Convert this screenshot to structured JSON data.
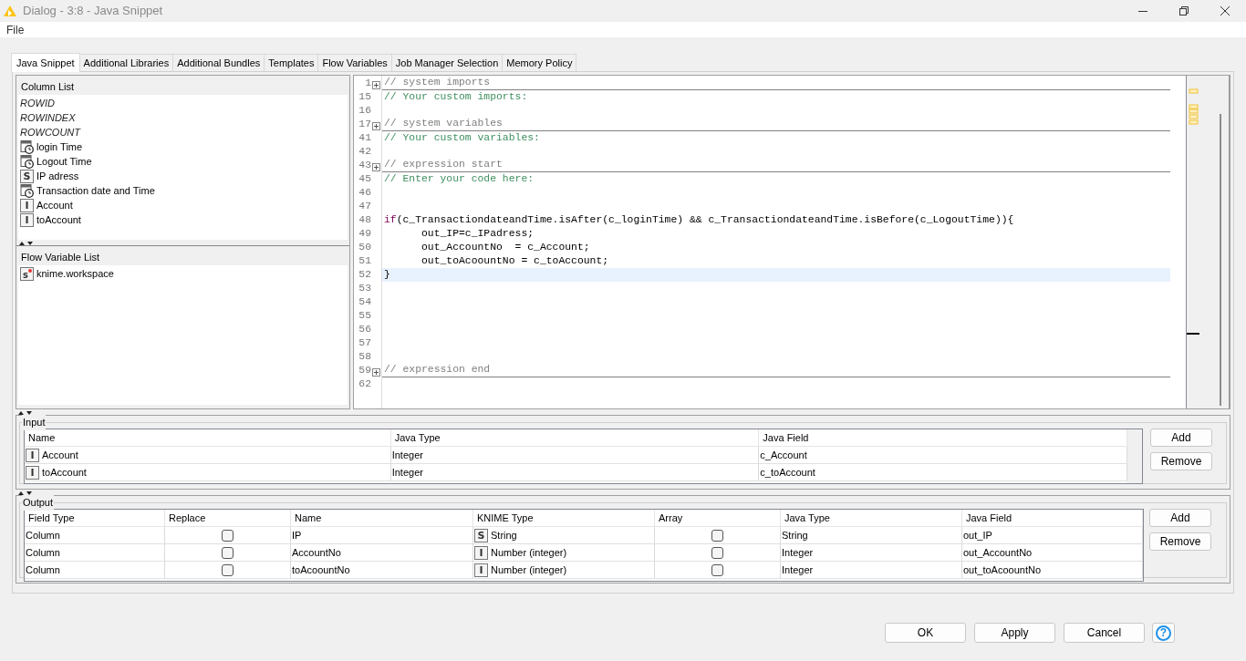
{
  "window": {
    "title": "Dialog - 3:8 - Java Snippet"
  },
  "menu": [
    "File"
  ],
  "tabs": [
    {
      "label": "Java Snippet",
      "selected": true
    },
    {
      "label": "Additional Libraries",
      "selected": false
    },
    {
      "label": "Additional Bundles",
      "selected": false
    },
    {
      "label": "Templates",
      "selected": false
    },
    {
      "label": "Flow Variables",
      "selected": false
    },
    {
      "label": "Job Manager Selection",
      "selected": false
    },
    {
      "label": "Memory Policy",
      "selected": false
    }
  ],
  "column_list": {
    "title": "Column List",
    "items": [
      {
        "label": "ROWID",
        "kind": "special"
      },
      {
        "label": "ROWINDEX",
        "kind": "special"
      },
      {
        "label": "ROWCOUNT",
        "kind": "special"
      },
      {
        "label": "login Time",
        "kind": "datetime"
      },
      {
        "label": "Logout Time",
        "kind": "datetime"
      },
      {
        "label": "IP adress",
        "kind": "typed",
        "icon": "S"
      },
      {
        "label": "Transaction date and Time",
        "kind": "datetime"
      },
      {
        "label": "Account",
        "kind": "typed",
        "icon": "I"
      },
      {
        "label": "toAccount",
        "kind": "typed",
        "icon": "I"
      }
    ]
  },
  "flow_variable_list": {
    "title": "Flow Variable List",
    "items": [
      {
        "label": "knime.workspace",
        "kind": "flow",
        "icon": "s"
      }
    ]
  },
  "editor": {
    "lines": [
      {
        "number": "1",
        "kind": "fold",
        "text": "// system imports",
        "current": false
      },
      {
        "number": "15",
        "kind": "comment",
        "text": "// Your custom imports:",
        "current": false
      },
      {
        "number": "16",
        "kind": "blank",
        "current": false
      },
      {
        "number": "17",
        "kind": "fold",
        "text": "// system variables",
        "current": false
      },
      {
        "number": "41",
        "kind": "comment",
        "text": "// Your custom variables:",
        "current": false
      },
      {
        "number": "42",
        "kind": "blank",
        "current": false
      },
      {
        "number": "43",
        "kind": "fold",
        "text": "// expression start",
        "current": false
      },
      {
        "number": "45",
        "kind": "comment",
        "text": "// Enter your code here:",
        "current": false
      },
      {
        "number": "46",
        "kind": "blank",
        "current": false
      },
      {
        "number": "47",
        "kind": "blank",
        "current": false
      },
      {
        "number": "48",
        "kind": "code",
        "keyword": "if",
        "text": "(c_TransactiondateandTime.isAfter(c_loginTime) && c_TransactiondateandTime.isBefore(c_LogoutTime)){",
        "current": false
      },
      {
        "number": "49",
        "kind": "code",
        "text": "      out_IP=c_IPadress;",
        "current": false
      },
      {
        "number": "50",
        "kind": "code",
        "text": "      out_AccountNo  = c_Account;",
        "current": false
      },
      {
        "number": "51",
        "kind": "code",
        "text": "      out_toAcoountNo = c_toAccount;",
        "current": false
      },
      {
        "number": "52",
        "kind": "code",
        "text": "}",
        "current": true
      },
      {
        "number": "53",
        "kind": "blank",
        "current": false
      },
      {
        "number": "54",
        "kind": "blank",
        "current": false
      },
      {
        "number": "55",
        "kind": "blank",
        "current": false
      },
      {
        "number": "56",
        "kind": "blank",
        "current": false
      },
      {
        "number": "57",
        "kind": "blank",
        "current": false
      },
      {
        "number": "58",
        "kind": "blank",
        "current": false
      },
      {
        "number": "59",
        "kind": "fold",
        "text": "// expression end",
        "current": false
      },
      {
        "number": "62",
        "kind": "blank",
        "current": false
      }
    ]
  },
  "input": {
    "title": "Input",
    "columns": [
      "Name",
      "Java Type",
      "Java Field"
    ],
    "rows": [
      {
        "name": "Account",
        "type_icon": "I",
        "java_type": "Integer",
        "java_field": "c_Account"
      },
      {
        "name": "toAccount",
        "type_icon": "I",
        "java_type": "Integer",
        "java_field": "c_toAccount"
      }
    ],
    "buttons": [
      "Add",
      "Remove"
    ]
  },
  "output": {
    "title": "Output",
    "columns": [
      "Field Type",
      "Replace",
      "Name",
      "KNIME Type",
      "Array",
      "Java Type",
      "Java Field"
    ],
    "rows": [
      {
        "field_type": "Column",
        "replace": false,
        "name": "IP",
        "knime_type_icon": "S",
        "knime_type": "String",
        "array": false,
        "java_type": "String",
        "java_field": "out_IP"
      },
      {
        "field_type": "Column",
        "replace": false,
        "name": "AccountNo",
        "knime_type_icon": "I",
        "knime_type": "Number (integer)",
        "array": false,
        "java_type": "Integer",
        "java_field": "out_AccountNo"
      },
      {
        "field_type": "Column",
        "replace": false,
        "name": "toAcoountNo",
        "knime_type_icon": "I",
        "knime_type": "Number (integer)",
        "array": false,
        "java_type": "Integer",
        "java_field": "out_toAcoountNo"
      }
    ],
    "buttons": [
      "Add",
      "Remove"
    ]
  },
  "footer_buttons": [
    "OK",
    "Apply",
    "Cancel"
  ],
  "help_button": "?"
}
